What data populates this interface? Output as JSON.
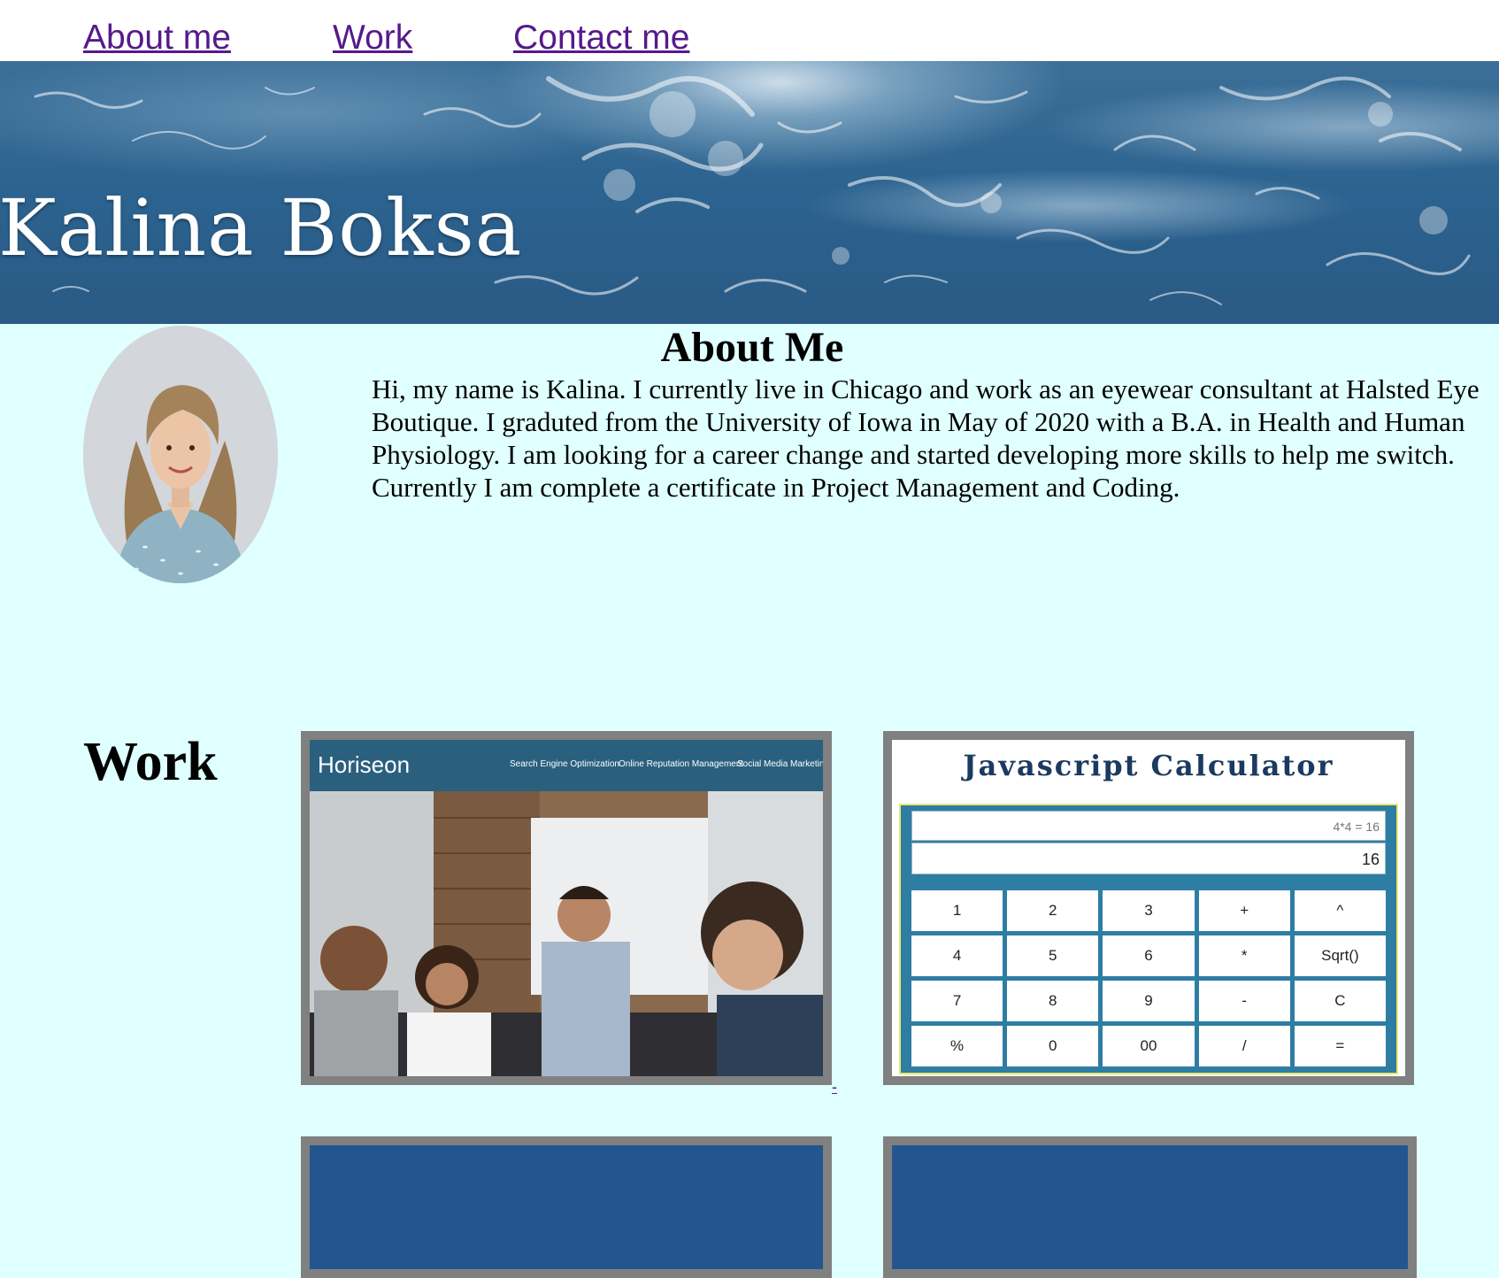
{
  "nav": {
    "about_label": "About me",
    "work_label": "Work",
    "contact_label": "Contact me"
  },
  "hero": {
    "title": "Kalina Boksa"
  },
  "about": {
    "heading": "About Me",
    "text": "Hi, my name is Kalina. I currently live in Chicago and work as an eyewear consultant at Halsted Eye Boutique. I graduted from the University of Iowa in May of 2020 with a B.A. in Health and Human Physiology. I am looking for a career change and started developing more skills to help me switch. Currently I am complete a certificate in Project Management and Coding."
  },
  "work": {
    "heading": "Work",
    "link_dash": "-",
    "horiseon": {
      "logo": "Horiseon",
      "nav": [
        "Search Engine Optimization",
        "Online Reputation Management",
        "Social Media Marketing"
      ]
    },
    "calculator": {
      "title": "Javascript Calculator",
      "expression": "4*4 = 16",
      "result": "16",
      "keys": [
        "1",
        "2",
        "3",
        "+",
        "^",
        "4",
        "5",
        "6",
        "*",
        "Sqrt()",
        "7",
        "8",
        "9",
        "-",
        "C",
        "%",
        "0",
        "00",
        "/",
        "="
      ]
    }
  },
  "colors": {
    "page_bg": "#e0ffff",
    "link": "#551a8b",
    "card_border": "#808080",
    "card_blue": "#23568f",
    "horiseon_header": "#2a607e",
    "calc_body": "#2e7da3"
  }
}
